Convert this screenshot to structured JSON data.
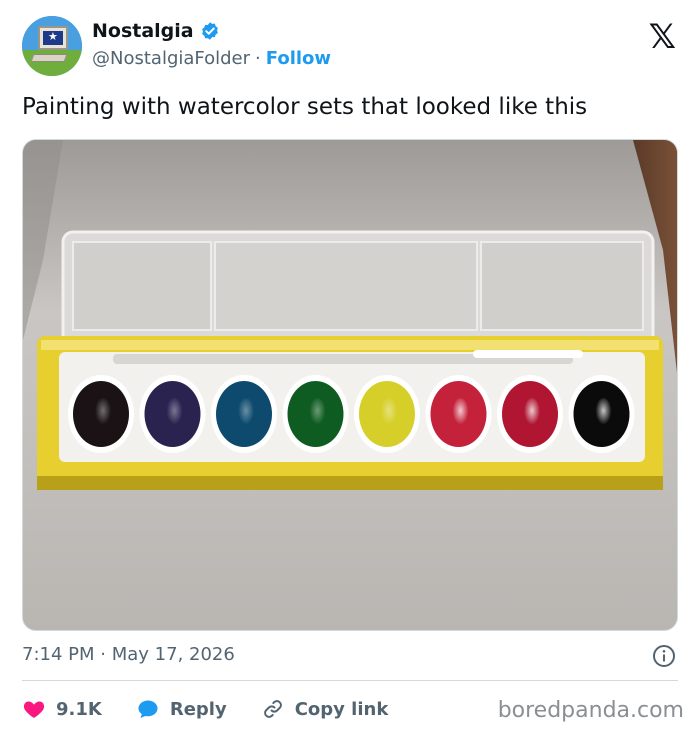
{
  "author": {
    "name": "Nostalgia",
    "handle": "@NostalgiaFolder",
    "separator": "·",
    "follow_label": "Follow"
  },
  "brand_icon": "x-logo-icon",
  "tweet": {
    "text": "Painting with watercolor sets that looked like this"
  },
  "media": {
    "paint_colors": [
      "#1a1214",
      "#2a2350",
      "#0d4a6e",
      "#0f5c22",
      "#d6cf2a",
      "#c4213a",
      "#b01632",
      "#0b0b0c"
    ],
    "tray_color": "#e6cf2f"
  },
  "meta": {
    "time": "7:14 PM",
    "separator": "·",
    "date": "May 17, 2026"
  },
  "actions": {
    "likes": "9.1K",
    "reply_label": "Reply",
    "copy_label": "Copy link"
  },
  "watermark": "boredpanda.com",
  "colors": {
    "accent": "#1d9bf0",
    "like": "#f91880",
    "secondary_text": "#536471"
  }
}
